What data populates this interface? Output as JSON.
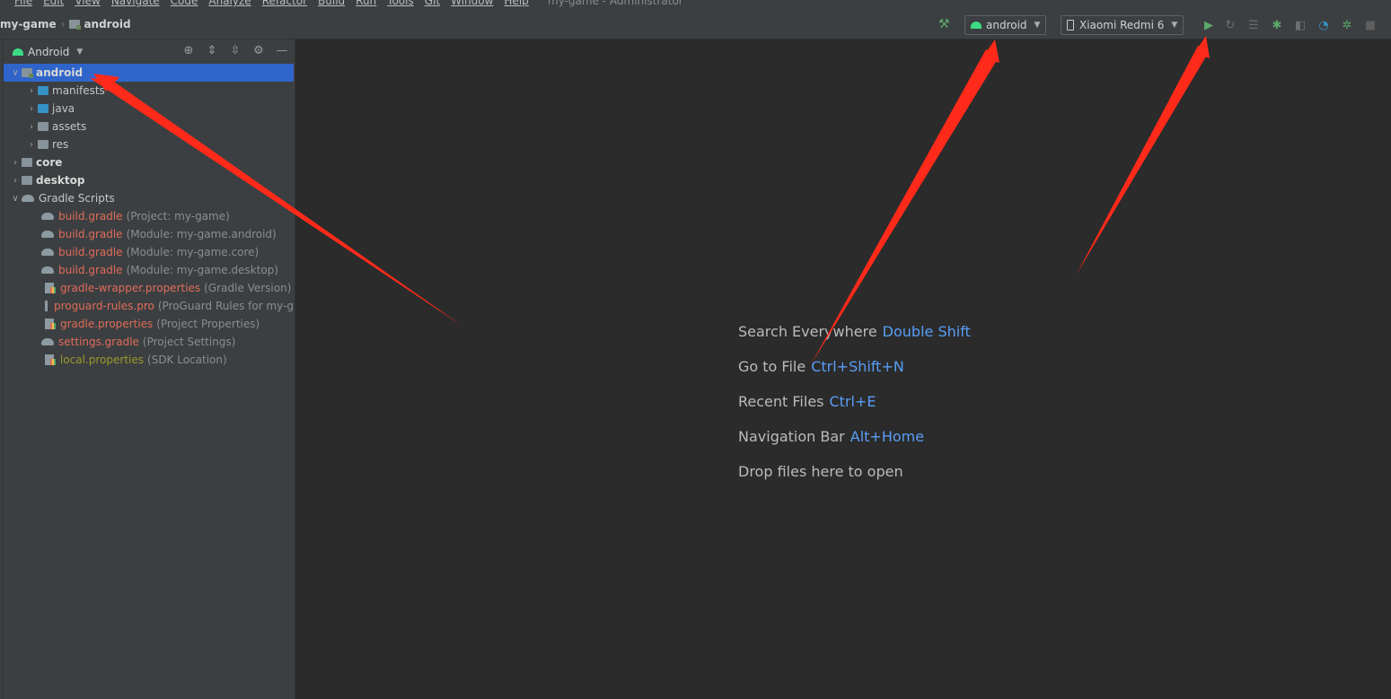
{
  "menu": [
    "File",
    "Edit",
    "View",
    "Navigate",
    "Code",
    "Analyze",
    "Refactor",
    "Build",
    "Run",
    "Tools",
    "Git",
    "Window",
    "Help"
  ],
  "window_title": "my-game - Administrator",
  "breadcrumb": {
    "project": "my-game",
    "module": "android"
  },
  "toolbar": {
    "run_config": "android",
    "device": "Xiaomi Redmi 6"
  },
  "project_panel": {
    "view_mode": "Android"
  },
  "tree": {
    "android": "android",
    "manifests": "manifests",
    "java": "java",
    "assets": "assets",
    "res": "res",
    "core": "core",
    "desktop": "desktop",
    "gradle_scripts": "Gradle Scripts",
    "files": [
      {
        "name": "build.gradle",
        "hint": "(Project: my-game)"
      },
      {
        "name": "build.gradle",
        "hint": "(Module: my-game.android)"
      },
      {
        "name": "build.gradle",
        "hint": "(Module: my-game.core)"
      },
      {
        "name": "build.gradle",
        "hint": "(Module: my-game.desktop)"
      },
      {
        "name": "gradle-wrapper.properties",
        "hint": "(Gradle Version)"
      },
      {
        "name": "proguard-rules.pro",
        "hint": "(ProGuard Rules for my-g"
      },
      {
        "name": "gradle.properties",
        "hint": "(Project Properties)"
      },
      {
        "name": "settings.gradle",
        "hint": "(Project Settings)"
      },
      {
        "name": "local.properties",
        "hint": "(SDK Location)"
      }
    ]
  },
  "editor_hints": [
    {
      "label": "Search Everywhere",
      "shortcut": "Double Shift"
    },
    {
      "label": "Go to File",
      "shortcut": "Ctrl+Shift+N"
    },
    {
      "label": "Recent Files",
      "shortcut": "Ctrl+E"
    },
    {
      "label": "Navigation Bar",
      "shortcut": "Alt+Home"
    },
    {
      "label": "Drop files here to open",
      "shortcut": ""
    }
  ],
  "colors": {
    "annotation_arrow": "#ff2a1a",
    "selection": "#2f65ca",
    "shortcut": "#589df6"
  }
}
